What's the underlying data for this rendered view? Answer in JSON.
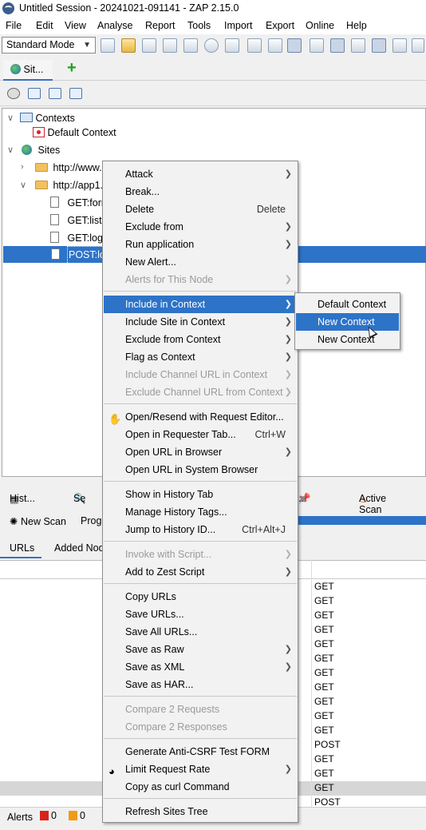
{
  "window": {
    "title": "Untitled Session - 20241021-091141 - ZAP 2.15.0"
  },
  "menubar": [
    "File",
    "Edit",
    "View",
    "Analyse",
    "Report",
    "Tools",
    "Import",
    "Export",
    "Online",
    "Help"
  ],
  "toolbar": {
    "mode": "Standard Mode"
  },
  "sites_tab": {
    "label": "Sit..."
  },
  "tree": {
    "contexts": "Contexts",
    "default_context": "Default Context",
    "sites": "Sites",
    "site1": "http://www.g",
    "site2": "http://app1.l",
    "get_form": "GET:forn",
    "get_list": "GET:list",
    "get_log": "GET:log",
    "post_lo": "POST:lo"
  },
  "context_menu": {
    "attack": "Attack",
    "break": "Break...",
    "delete": "Delete",
    "delete_acc": "Delete",
    "exclude_from": "Exclude from",
    "run_application": "Run application",
    "new_alert": "New Alert...",
    "alerts_for_node": "Alerts for This Node",
    "include_in_context": "Include in Context",
    "include_site_in_context": "Include Site in Context",
    "exclude_from_context": "Exclude from Context",
    "flag_as_context": "Flag as Context",
    "include_channel_url": "Include Channel URL in Context",
    "exclude_channel_url": "Exclude Channel URL from Context",
    "open_resend": "Open/Resend with Request Editor...",
    "open_requester": "Open in Requester Tab...",
    "open_requester_acc": "Ctrl+W",
    "open_url_browser": "Open URL in Browser",
    "open_url_system": "Open URL in System Browser",
    "show_history": "Show in History Tab",
    "manage_tags": "Manage History Tags...",
    "jump_history": "Jump to History ID...",
    "jump_history_acc": "Ctrl+Alt+J",
    "invoke_script": "Invoke with Script...",
    "add_zest": "Add to Zest Script",
    "copy_urls": "Copy URLs",
    "save_urls": "Save URLs...",
    "save_all_urls": "Save All URLs...",
    "save_raw": "Save as Raw",
    "save_xml": "Save as XML",
    "save_har": "Save as HAR...",
    "compare_requests": "Compare 2 Requests",
    "compare_responses": "Compare 2 Responses",
    "gen_csrf": "Generate Anti-CSRF Test FORM",
    "limit_rate": "Limit Request Rate",
    "copy_curl": "Copy as curl Command",
    "refresh_tree": "Refresh Sites Tree"
  },
  "submenu": {
    "item1": "Default Context",
    "item2": "New Context",
    "item3": "New Context"
  },
  "bottom_tabs": {
    "history": "Hist...",
    "search": "Se",
    "dots": "...",
    "active_scan": "Active Scan"
  },
  "scan": {
    "new_scan": "New Scan",
    "progress": "Prog"
  },
  "subtabs": {
    "urls": "URLs",
    "added_nodes": "Added Nod"
  },
  "methods": [
    "GET",
    "GET",
    "GET",
    "GET",
    "GET",
    "GET",
    "GET",
    "GET",
    "GET",
    "GET",
    "GET",
    "POST",
    "GET",
    "GET",
    "GET",
    "POST"
  ],
  "status": {
    "alerts": "Alerts",
    "count1": "0",
    "count2": "0"
  }
}
